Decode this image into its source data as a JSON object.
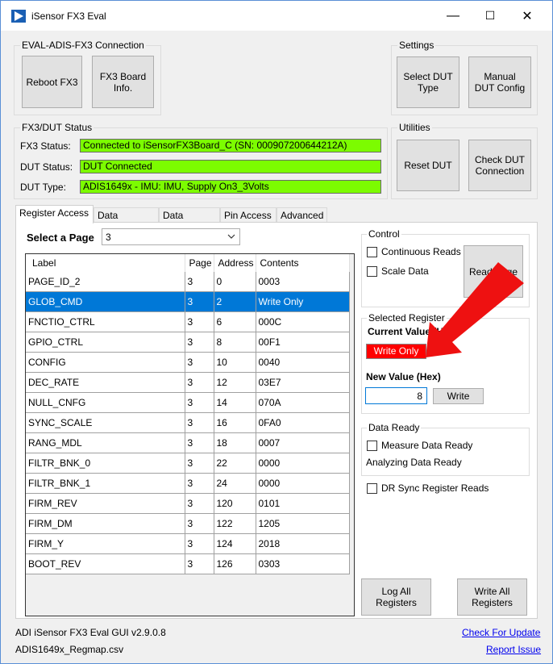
{
  "window": {
    "title": "iSensor FX3 Eval",
    "controls": {
      "minimize": "—",
      "maximize": "☐",
      "close": "✕"
    }
  },
  "connection": {
    "label": "EVAL-ADIS-FX3 Connection",
    "reboot_button": "Reboot FX3",
    "board_info_button": "FX3 Board\nInfo."
  },
  "settings": {
    "label": "Settings",
    "select_dut_button": "Select DUT\nType",
    "manual_config_button": "Manual\nDUT Config"
  },
  "status": {
    "label": "FX3/DUT Status",
    "fx3_label": "FX3 Status:",
    "fx3_value": "Connected to iSensorFX3Board_C (SN: 000907200644212A)",
    "dut_status_label": "DUT Status:",
    "dut_status_value": "DUT Connected",
    "dut_type_label": "DUT Type:",
    "dut_type_value": "ADIS1649x - IMU: IMU, Supply On3_3Volts",
    "field_color": "#7cfc00"
  },
  "utilities": {
    "label": "Utilities",
    "reset_button": "Reset DUT",
    "check_button": "Check DUT\nConnection"
  },
  "tabs": [
    "Register Access",
    "Data Logging",
    "Data Plotting",
    "Pin Access",
    "Advanced"
  ],
  "page_select": {
    "label": "Select a Page",
    "value": "3"
  },
  "table": {
    "headers": [
      "Label",
      "Page",
      "Address",
      "Contents"
    ],
    "selected_index": 1,
    "rows": [
      [
        "PAGE_ID_2",
        "3",
        "0",
        "0003"
      ],
      [
        "GLOB_CMD",
        "3",
        "2",
        "Write Only"
      ],
      [
        "FNCTIO_CTRL",
        "3",
        "6",
        "000C"
      ],
      [
        "GPIO_CTRL",
        "3",
        "8",
        "00F1"
      ],
      [
        "CONFIG",
        "3",
        "10",
        "0040"
      ],
      [
        "DEC_RATE",
        "3",
        "12",
        "03E7"
      ],
      [
        "NULL_CNFG",
        "3",
        "14",
        "070A"
      ],
      [
        "SYNC_SCALE",
        "3",
        "16",
        "0FA0"
      ],
      [
        "RANG_MDL",
        "3",
        "18",
        "0007"
      ],
      [
        "FILTR_BNK_0",
        "3",
        "22",
        "0000"
      ],
      [
        "FILTR_BNK_1",
        "3",
        "24",
        "0000"
      ],
      [
        "FIRM_REV",
        "3",
        "120",
        "0101"
      ],
      [
        "FIRM_DM",
        "3",
        "122",
        "1205"
      ],
      [
        "FIRM_Y",
        "3",
        "124",
        "2018"
      ],
      [
        "BOOT_REV",
        "3",
        "126",
        "0303"
      ]
    ]
  },
  "control": {
    "label": "Control",
    "continuous_reads": "Continuous Reads",
    "scale_data": "Scale Data",
    "read_page_button": "Read Page"
  },
  "selected_register": {
    "label": "Selected Register",
    "current_value_label": "Current Value (Hex)",
    "current_value": "Write Only",
    "current_value_color": "#ff0000",
    "new_value_label": "New Value (Hex)",
    "new_value": "8",
    "write_button": "Write"
  },
  "data_ready": {
    "label": "Data Ready",
    "measure": "Measure Data Ready",
    "analyzing": "Analyzing Data Ready"
  },
  "dr_sync": "DR Sync Register Reads",
  "log_all_button": "Log All\nRegisters",
  "write_all_button": "Write All\nRegisters",
  "footer": {
    "version": "ADI iSensor FX3 Eval GUI v2.9.0.8",
    "regmap": "ADIS1649x_Regmap.csv",
    "check_update": "Check For Update",
    "report_issue": "Report Issue"
  },
  "annotation": {
    "arrow_color": "#ee1111"
  }
}
